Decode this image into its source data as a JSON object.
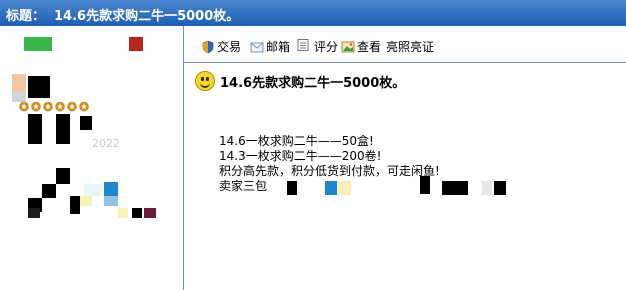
{
  "header": {
    "label": "标题：",
    "title": "14.6先款求购二牛一5000枚。"
  },
  "toolbar": {
    "items": [
      {
        "label": "交易",
        "icon": "shield-icon"
      },
      {
        "label": "邮箱",
        "icon": "envelope-icon"
      },
      {
        "label": "",
        "icon": "document-icon"
      },
      {
        "label": "评分",
        "icon": ""
      },
      {
        "label": "查看",
        "icon": "picture-icon"
      },
      {
        "label": "亮照亮证",
        "icon": ""
      }
    ]
  },
  "post": {
    "subject": "14.6先款求购二牛一5000枚。",
    "lines": [
      "14.6一枚求购二牛——50盒!",
      "14.3一枚求购二牛——200卷!",
      "积分高先款，积分低货到付款，可走闲鱼!",
      "卖家三包"
    ]
  },
  "user": {
    "rating_stars": 6,
    "faint_text": "2022"
  },
  "colors": {
    "titlebar": "#2a6cc0",
    "divider": "#6f8fbf"
  }
}
